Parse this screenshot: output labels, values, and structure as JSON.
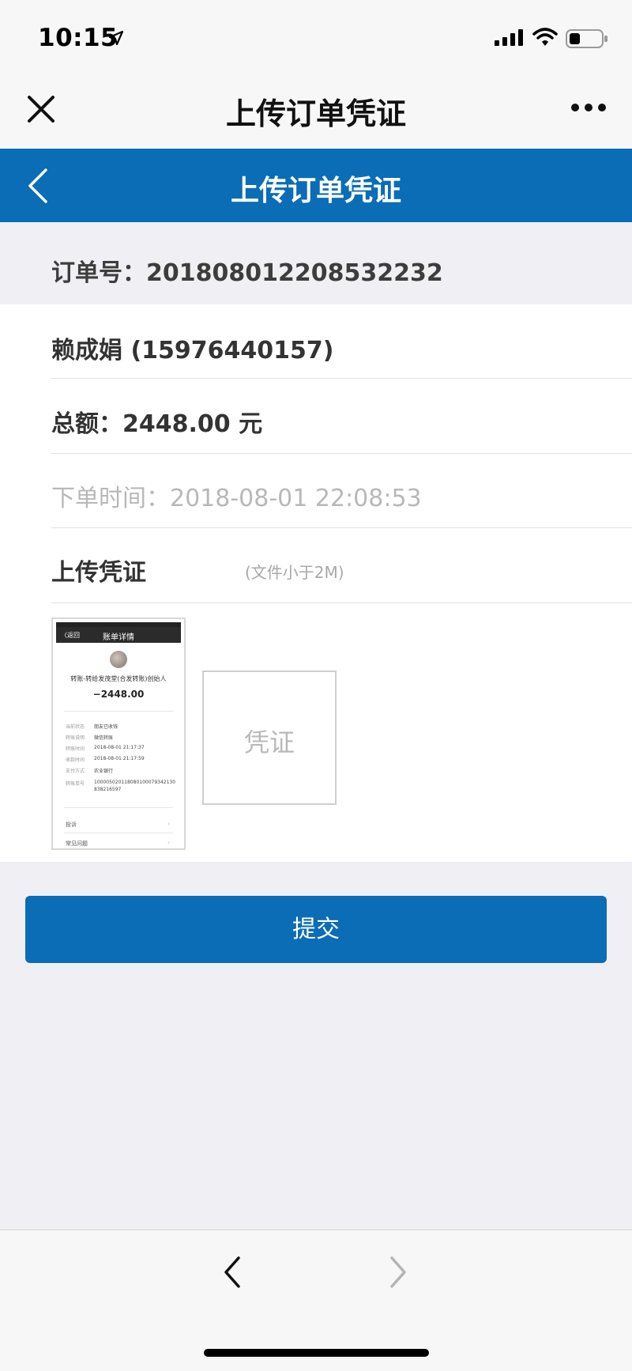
{
  "status_bar": {
    "time": "10:15",
    "icons": [
      "location-arrow-icon",
      "signal-icon",
      "wifi-icon",
      "battery-icon"
    ]
  },
  "wechat_bar": {
    "title": "上传订单凭证",
    "icons": [
      "close-icon",
      "more-icon"
    ]
  },
  "app_bar": {
    "title": "上传订单凭证",
    "icons": [
      "back-chevron-icon"
    ],
    "color": "#0a6db5"
  },
  "order": {
    "number_label": "订单号：20180801220853223​2",
    "name_phone": "赖成娟 (15976440157)",
    "total_label": "总额：",
    "total_value": "2448.00 元",
    "order_time": "下单时间：2018-08-01 22:08:53"
  },
  "upload": {
    "label": "上传凭证",
    "hint": "(文件小于2M)",
    "placeholder": "凭证"
  },
  "thumbnail": {
    "nav_back": "〈返回",
    "nav_title": "账单详情",
    "desc": "转账-转给发茂堂(合发转账)创始人",
    "amount": "−2448.00",
    "rows": [
      {
        "k": "当前状态",
        "v": "朋友已收钱"
      },
      {
        "k": "转账说明",
        "v": "微信转账"
      },
      {
        "k": "转账时间",
        "v": "2018-08-01 21:17:37"
      },
      {
        "k": "收款时间",
        "v": "2018-08-01 21:17:59"
      },
      {
        "k": "支付方式",
        "v": "农业银行"
      },
      {
        "k": "转账单号",
        "v": "1000050201180801000793421​30"
      },
      {
        "k": "",
        "v": "838216597"
      }
    ],
    "footer": [
      "投诉",
      "常见问题"
    ]
  },
  "submit_label": "提交",
  "browser_toolbar": {
    "icons": [
      "nav-back-icon",
      "nav-forward-icon"
    ]
  },
  "colors": {
    "accent": "#0a6db5",
    "background": "#efeff4"
  }
}
